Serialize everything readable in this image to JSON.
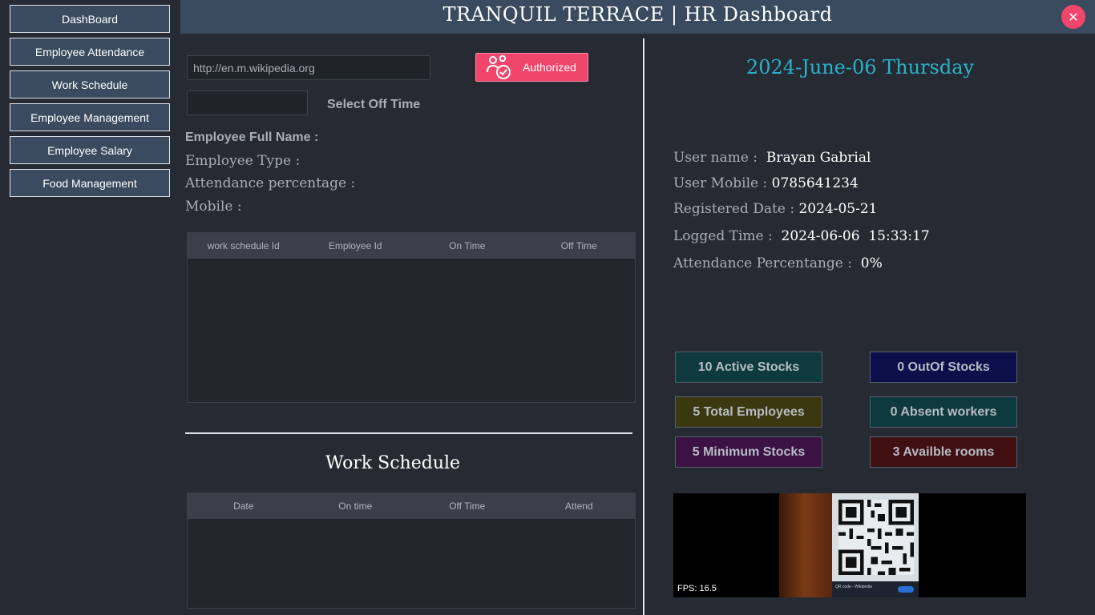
{
  "sidebar": {
    "items": [
      {
        "label": "DashBoard"
      },
      {
        "label": "Employee Attendance"
      },
      {
        "label": "Work Schedule"
      },
      {
        "label": "Employee Management"
      },
      {
        "label": "Employee Salary"
      },
      {
        "label": "Food Management"
      }
    ]
  },
  "header": {
    "title": "TRANQUIL TERRACE | HR Dashboard",
    "close_icon": "close-icon"
  },
  "scan": {
    "url_value": "http://en.m.wikipedia.org",
    "authorized_label": "Authorized",
    "auth_icon": "user-check-icon",
    "off_time_value": "",
    "off_time_label": "Select Off Time"
  },
  "employee": {
    "full_name_label": "Employee Full Name :",
    "type_label": "Employee Type :",
    "attendance_label": "Attendance percentage :",
    "mobile_label": "Mobile :"
  },
  "schedule_table": {
    "columns": [
      "work schedule Id",
      "Employee Id",
      "On Time",
      "Off Time"
    ],
    "rows": []
  },
  "work_schedule": {
    "title": "Work Schedule",
    "columns": [
      "Date",
      "On time",
      "Off Time",
      "Attend"
    ],
    "rows": []
  },
  "user": {
    "date_title": "2024-June-06 Thursday",
    "name_label": "User name :",
    "name_value": "Brayan Gabrial",
    "mobile_label": "User Mobile :",
    "mobile_value": "0785641234",
    "registered_label": "Registered Date :",
    "registered_value": "2024-05-21",
    "logged_label": "Logged Time :",
    "logged_value": "2024-06-06  15:33:17",
    "attendance_label": "Attendance Percentange :",
    "attendance_value": "0%"
  },
  "stats": [
    {
      "label": "10 Active Stocks",
      "color": "#0f3a3d"
    },
    {
      "label": "0 OutOf Stocks",
      "color": "#0d0f4a"
    },
    {
      "label": "5 Total Employees",
      "color": "#3b3810"
    },
    {
      "label": "0 Absent workers",
      "color": "#0f3a3d"
    },
    {
      "label": "5 Minimum Stocks",
      "color": "#3c1244"
    },
    {
      "label": "3 Availble rooms",
      "color": "#3f0f12"
    }
  ],
  "camera": {
    "fps_text": "FPS: 16.5",
    "screen_caption": "QR code - Wikipedia"
  },
  "colors": {
    "accent": "#f0466b",
    "header": "#3a4b5f",
    "date": "#2ab2c8",
    "background": "#262b33"
  }
}
